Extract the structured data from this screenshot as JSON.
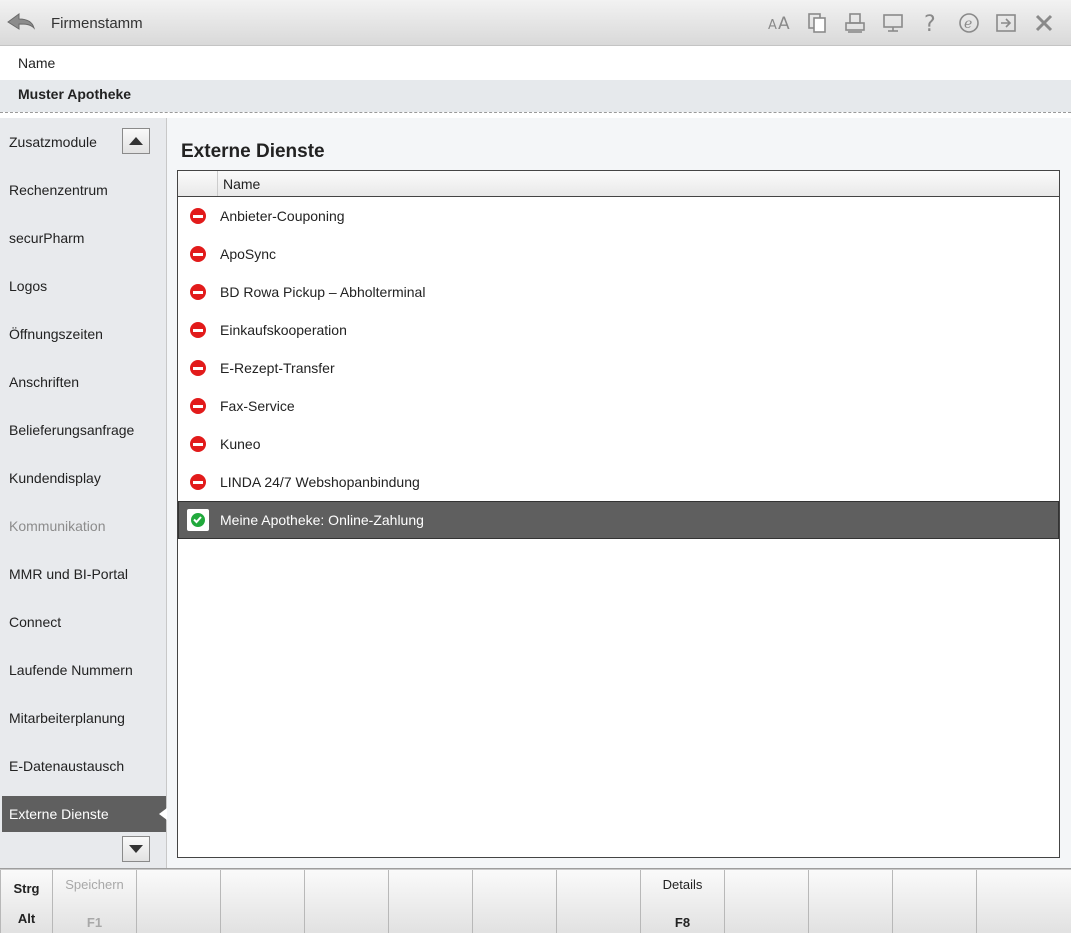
{
  "window": {
    "title": "Firmenstamm",
    "toolbar_icons": [
      "font-size-icon",
      "copy-icon",
      "print-icon",
      "monitor-icon",
      "help-icon",
      "info-e-icon",
      "export-icon",
      "close-icon"
    ]
  },
  "header": {
    "name_label": "Name",
    "name_value": "Muster Apotheke"
  },
  "sidebar": {
    "items": [
      {
        "label": "Zusatzmodule",
        "state": "normal"
      },
      {
        "label": "Rechenzentrum",
        "state": "normal"
      },
      {
        "label": "securPharm",
        "state": "normal"
      },
      {
        "label": "Logos",
        "state": "normal"
      },
      {
        "label": "Öffnungszeiten",
        "state": "normal"
      },
      {
        "label": "Anschriften",
        "state": "normal"
      },
      {
        "label": "Belieferungsanfrage",
        "state": "normal"
      },
      {
        "label": "Kundendisplay",
        "state": "normal"
      },
      {
        "label": "Kommunikation",
        "state": "disabled"
      },
      {
        "label": "MMR und BI-Portal",
        "state": "normal"
      },
      {
        "label": "Connect",
        "state": "normal"
      },
      {
        "label": "Laufende Nummern",
        "state": "normal"
      },
      {
        "label": "Mitarbeiterplanung",
        "state": "normal"
      },
      {
        "label": "E-Datenaustausch",
        "state": "normal"
      },
      {
        "label": "Externe Dienste",
        "state": "active"
      }
    ]
  },
  "main": {
    "title": "Externe Dienste",
    "table": {
      "column_name": "Name",
      "rows": [
        {
          "name": "Anbieter-Couponing",
          "status": "inactive"
        },
        {
          "name": "ApoSync",
          "status": "inactive"
        },
        {
          "name": "BD Rowa Pickup – Abholterminal",
          "status": "inactive"
        },
        {
          "name": "Einkaufskooperation",
          "status": "inactive"
        },
        {
          "name": "E-Rezept-Transfer",
          "status": "inactive"
        },
        {
          "name": "Fax-Service",
          "status": "inactive"
        },
        {
          "name": "Kuneo",
          "status": "inactive"
        },
        {
          "name": "LINDA 24/7 Webshopanbindung",
          "status": "inactive"
        },
        {
          "name": "Meine Apotheke: Online-Zahlung",
          "status": "active",
          "selected": true
        }
      ]
    }
  },
  "function_bar": {
    "modifiers": {
      "top": "Strg",
      "bottom": "Alt"
    },
    "keys": [
      {
        "label": "Speichern",
        "key": "F1",
        "enabled": false
      },
      {
        "label": "",
        "key": "",
        "enabled": false
      },
      {
        "label": "",
        "key": "",
        "enabled": false
      },
      {
        "label": "",
        "key": "",
        "enabled": false
      },
      {
        "label": "",
        "key": "",
        "enabled": false
      },
      {
        "label": "",
        "key": "",
        "enabled": false
      },
      {
        "label": "",
        "key": "",
        "enabled": false
      },
      {
        "label": "Details",
        "key": "F8",
        "enabled": true
      },
      {
        "label": "",
        "key": "",
        "enabled": false
      },
      {
        "label": "",
        "key": "",
        "enabled": false
      },
      {
        "label": "",
        "key": "",
        "enabled": false
      },
      {
        "label": "",
        "key": "",
        "enabled": false
      }
    ]
  },
  "colors": {
    "selection": "#5f5f5f",
    "inactive_status": "#e21b1b",
    "active_status": "#21a93c",
    "sidebar_bg": "#e8eaed"
  }
}
